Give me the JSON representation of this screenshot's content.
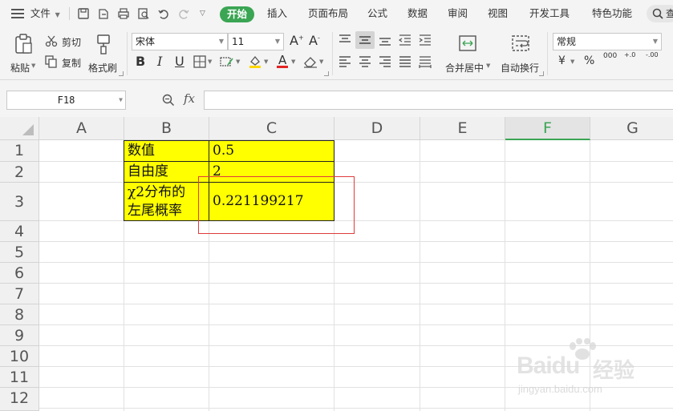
{
  "menu": {
    "file_label": "文件",
    "tabs": [
      "开始",
      "插入",
      "页面布局",
      "公式",
      "数据",
      "审阅",
      "视图",
      "开发工具",
      "特色功能"
    ],
    "search_label": "查"
  },
  "ribbon": {
    "paste_label": "粘贴",
    "cut_label": "剪切",
    "copy_label": "复制",
    "format_painter_label": "格式刷",
    "font_name": "宋体",
    "font_size": "11",
    "bold": "B",
    "italic": "I",
    "underline": "U",
    "merge_center_label": "合并居中",
    "wrap_text_label": "自动换行",
    "number_format": "常规",
    "currency_symbol": "¥",
    "percent_symbol": "%",
    "thousands_symbol": "000",
    "inc_decimal": "+.0",
    "dec_decimal": "-.00",
    "accent_color": "#3aa553",
    "font_color": "#e32424",
    "fill_color": "#ffd700"
  },
  "formula_bar": {
    "name_box": "F18",
    "fx_label": "fx",
    "formula": ""
  },
  "sheet": {
    "columns": [
      "A",
      "B",
      "C",
      "D",
      "E",
      "F",
      "G"
    ],
    "rows": [
      "1",
      "2",
      "3",
      "4",
      "5",
      "6",
      "7",
      "8",
      "9",
      "10",
      "11",
      "12"
    ],
    "selected_column": "F",
    "cells": {
      "B1": "数值",
      "C1": "0.5",
      "B2": "自由度",
      "C2": "2",
      "B3_line1": "χ2分布的",
      "B3_line2": "左尾概率",
      "C3": "0.221199217"
    },
    "cell_fill_color": "#ffff00",
    "highlight_box_color": "#e03c3c"
  },
  "watermark": {
    "brand": "Baidu",
    "brand_cn": "经验",
    "url": "jingyan.baidu.com"
  }
}
